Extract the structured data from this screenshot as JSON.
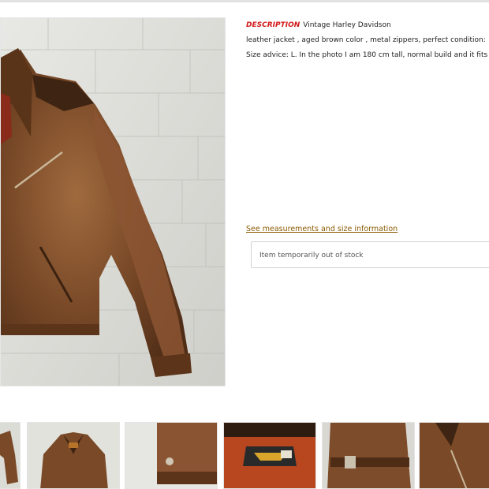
{
  "description": {
    "label": "DESCRIPTION",
    "title": "Vintage Harley Davidson",
    "line2": "leather jacket , aged brown color , metal zippers, perfect condition:",
    "line3": "Size advice: L. In the photo I am 180 cm tall, normal build and it fits"
  },
  "size_link": "See measurements and size information",
  "stock_status": "Item temporarily out of stock",
  "thumbnails": [
    {
      "icon": "jacket-sleeve-thumbnail"
    },
    {
      "icon": "jacket-front-thumbnail"
    },
    {
      "icon": "jacket-hem-thumbnail"
    },
    {
      "icon": "jacket-label-thumbnail"
    },
    {
      "icon": "jacket-buckle-thumbnail"
    },
    {
      "icon": "jacket-collar-thumbnail"
    }
  ],
  "colors": {
    "label_red": "#d11a1a",
    "link_brown": "#8a5a00",
    "leather_brown": "#7a4a28"
  }
}
